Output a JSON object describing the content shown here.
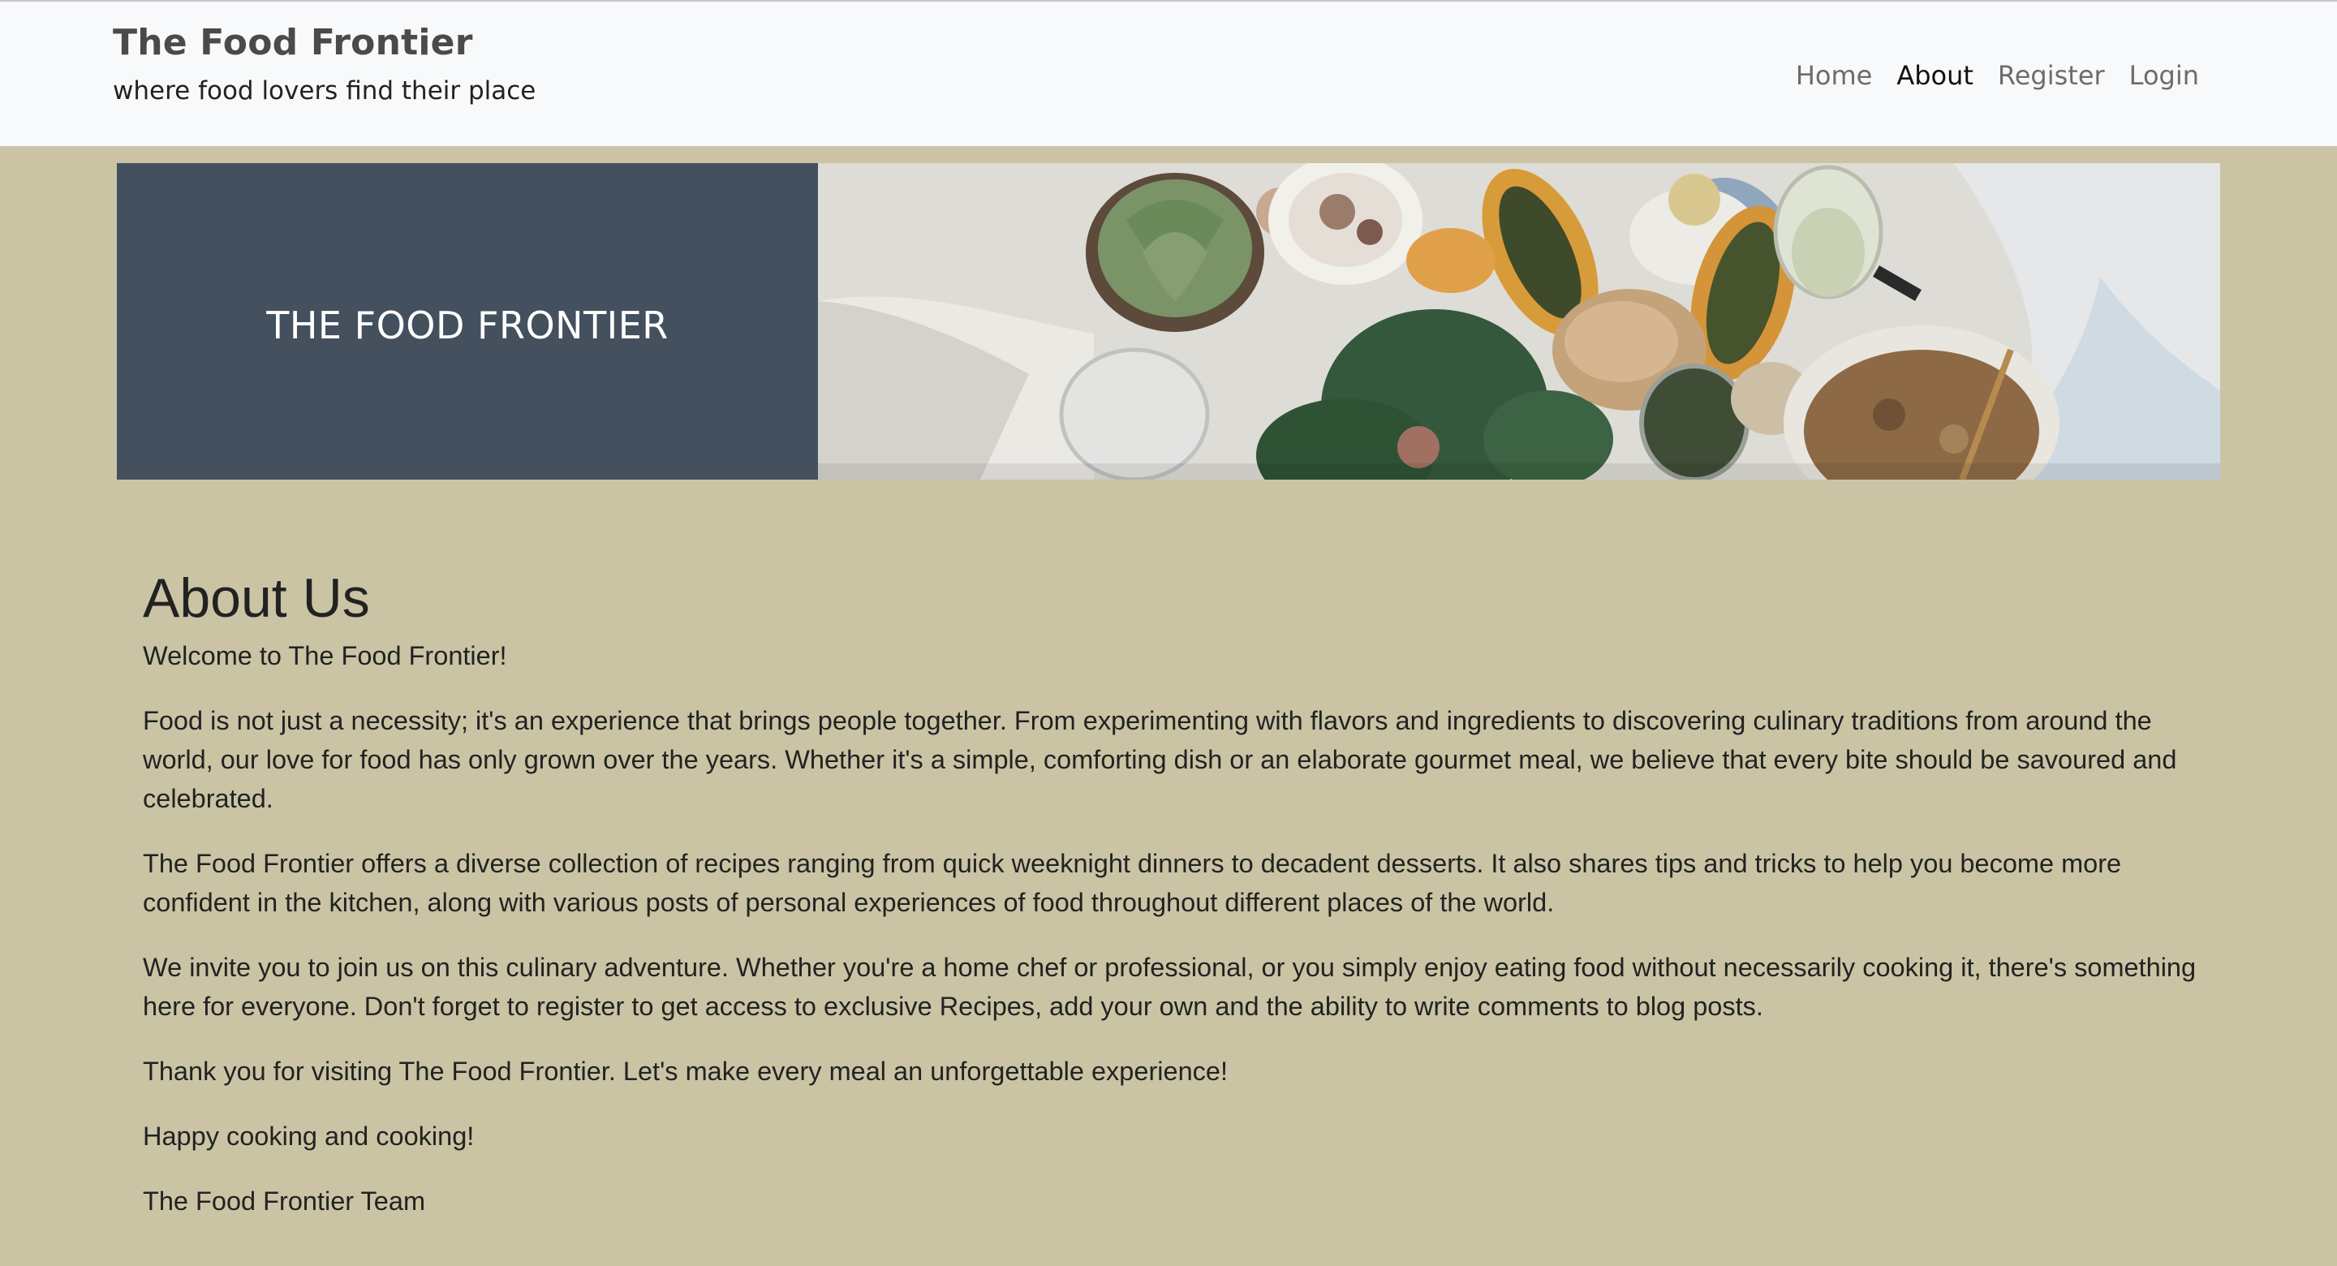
{
  "navbar": {
    "brand_title": "The Food Frontier",
    "brand_tagline": "where food lovers find their place",
    "links": [
      {
        "label": "Home",
        "active": false
      },
      {
        "label": "About",
        "active": true
      },
      {
        "label": "Register",
        "active": false
      },
      {
        "label": "Login",
        "active": false
      }
    ]
  },
  "hero": {
    "title": "THE FOOD FRONTIER",
    "panel_color": "#44505e",
    "image_icon": "food-table-photo"
  },
  "about": {
    "heading": "About Us",
    "paragraphs": [
      "Welcome to The Food Frontier!",
      "Food is not just a necessity; it's an experience that brings people together. From experimenting with flavors and ingredients to discovering culinary traditions from around the world, our love for food has only grown over the years. Whether it's a simple, comforting dish or an elaborate gourmet meal, we believe that every bite should be savoured and celebrated.",
      "The Food Frontier offers a diverse collection of recipes ranging from quick weeknight dinners to decadent desserts. It also shares tips and tricks to help you become more confident in the kitchen, along with various posts of personal experiences of food throughout different places of the world.",
      "We invite you to join us on this culinary adventure. Whether you're a home chef or professional, or you simply enjoy eating food without necessarily cooking it, there's something here for everyone. Don't forget to register to get access to exclusive Recipes, add your own and the ability to write comments to blog posts.",
      "Thank you for visiting The Food Frontier. Let's make every meal an unforgettable experience!",
      "Happy cooking and cooking!",
      "The Food Frontier Team"
    ]
  },
  "colors": {
    "page_background": "#cac4a5",
    "navbar_background": "#f8f9fa"
  }
}
